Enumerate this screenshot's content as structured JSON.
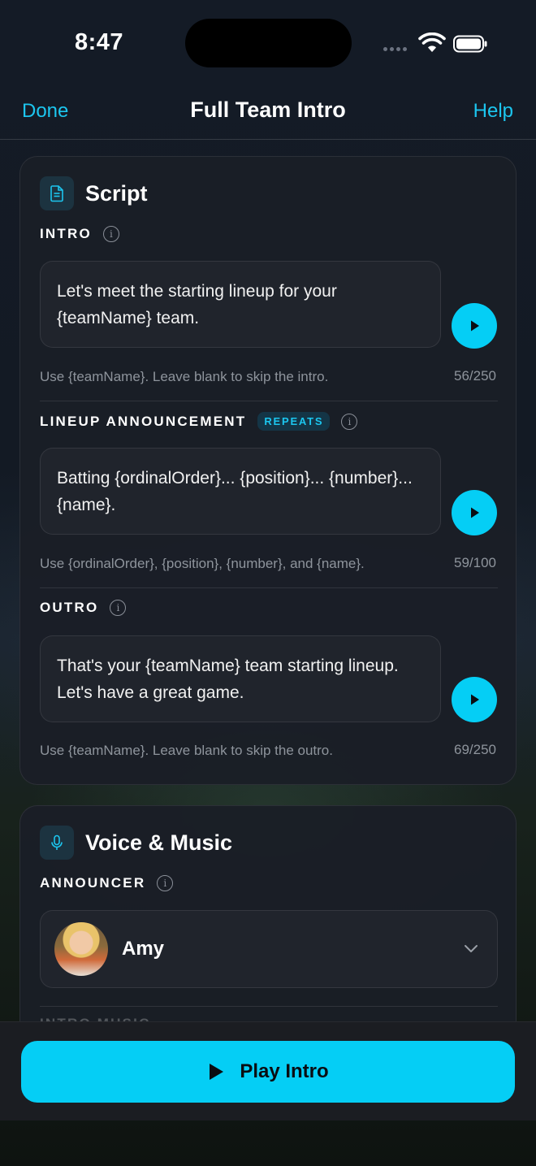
{
  "status_bar": {
    "time": "8:47"
  },
  "nav": {
    "done_label": "Done",
    "title": "Full Team Intro",
    "help_label": "Help"
  },
  "script_card": {
    "title": "Script",
    "intro": {
      "label": "INTRO",
      "text": "Let's meet the starting lineup for your {teamName} team.",
      "hint": "Use {teamName}. Leave blank to skip the intro.",
      "counter": "56/250"
    },
    "lineup": {
      "label": "LINEUP ANNOUNCEMENT",
      "badge": "REPEATS",
      "text": "Batting {ordinalOrder}... {position}... {number}... {name}.",
      "hint": "Use {ordinalOrder}, {position}, {number}, and {name}.",
      "counter": "59/100"
    },
    "outro": {
      "label": "OUTRO",
      "text": "That's your {teamName} team starting lineup. Let's have a great game.",
      "hint": "Use {teamName}. Leave blank to skip the outro.",
      "counter": "69/250"
    }
  },
  "voice_card": {
    "title": "Voice & Music",
    "announcer_label": "ANNOUNCER",
    "announcer_name": "Amy",
    "next_label_partial": "INTRO MUSIC"
  },
  "bottom": {
    "play_intro_label": "Play Intro"
  },
  "colors": {
    "accent": "#05cef5",
    "link": "#1cc6ef",
    "card_bg": "#1a1e26"
  },
  "icons": {
    "script": "document-icon",
    "voice": "microphone-icon",
    "info": "info-icon",
    "play": "play-icon",
    "chevron": "chevron-down-icon"
  }
}
